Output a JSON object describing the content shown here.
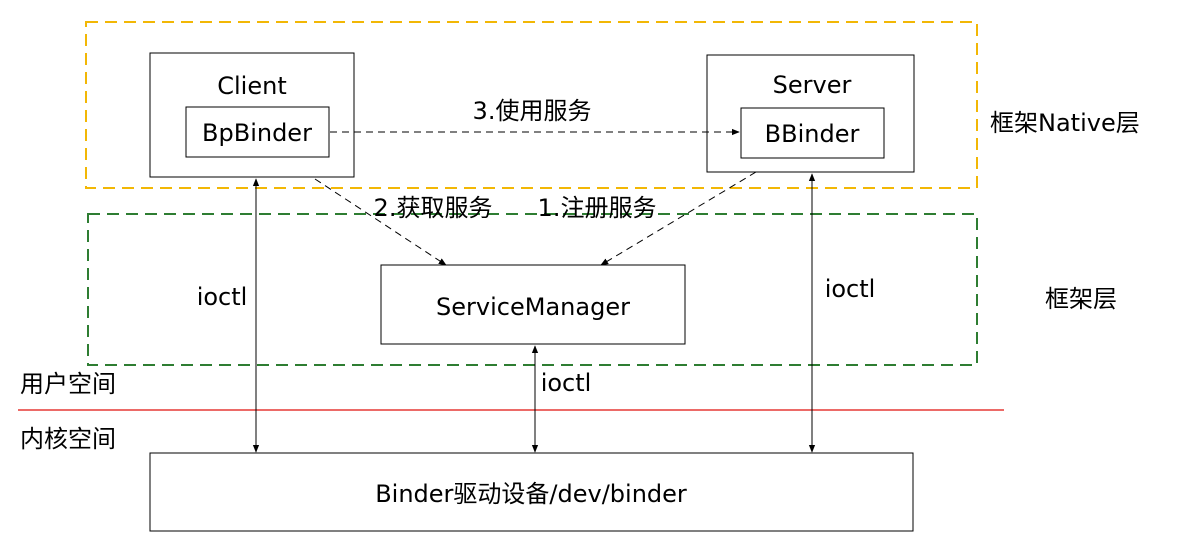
{
  "colors": {
    "native_layer_border": "#F2B705",
    "framework_layer_border": "#2E7D32",
    "divider": "#E53935",
    "box_stroke": "#000000",
    "arrow": "#000000"
  },
  "nodes": {
    "client": "Client",
    "bp_binder": "BpBinder",
    "server": "Server",
    "b_binder": "BBinder",
    "service_manager": "ServiceManager",
    "binder_driver": "Binder驱动设备/dev/binder"
  },
  "edges": {
    "use_service": "3.使用服务",
    "get_service": "2.获取服务",
    "register_service": "1.注册服务",
    "ioctl_client": "ioctl",
    "ioctl_service_manager": "ioctl",
    "ioctl_server": "ioctl"
  },
  "layers": {
    "native": "框架Native层",
    "framework": "框架层",
    "user_space": "用户空间",
    "kernel_space": "内核空间"
  }
}
